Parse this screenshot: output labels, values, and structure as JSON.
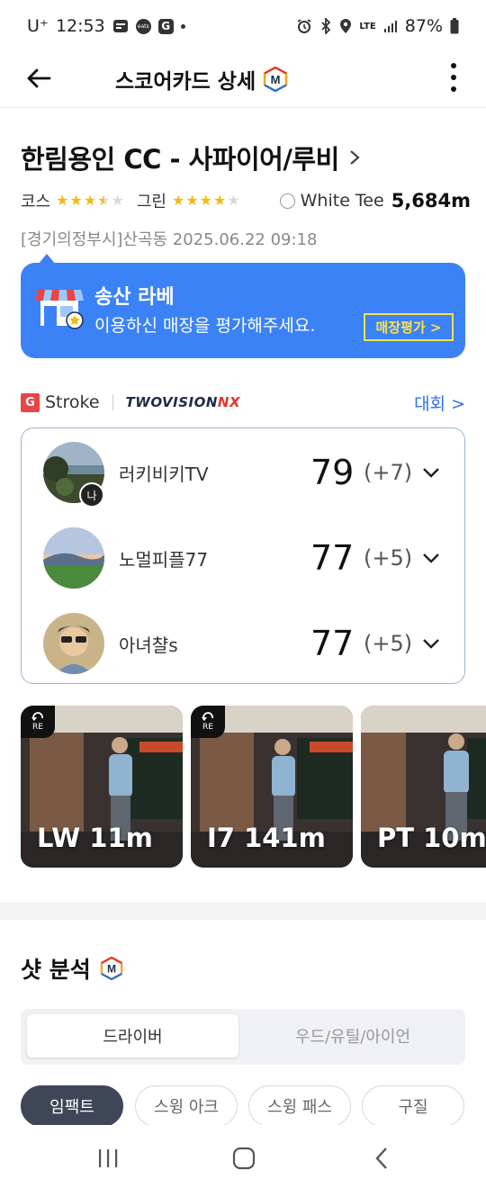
{
  "status_bar": {
    "carrier": "U⁺",
    "time": "12:53",
    "notif_eats": "eats",
    "notif_g": "G",
    "network": "LTE",
    "battery": "87%"
  },
  "header": {
    "title": "스코어카드 상세",
    "m_badge": "M"
  },
  "course": {
    "name": "한림용인 CC - 사파이어/루비",
    "course_label": "코스",
    "course_rating": 3.5,
    "green_label": "그린",
    "green_rating": 4,
    "tee_name": "White Tee",
    "tee_distance": "5,684m",
    "location_datetime": "[경기의정부시]산곡동 2025.06.22 09:18"
  },
  "promo": {
    "store_name": "송산 라베",
    "message": "이용하신 매장을 평가해주세요.",
    "button_label": "매장평가 >"
  },
  "brand": {
    "g_letter": "G",
    "mode": "Stroke",
    "system_main": "TWOVISION",
    "system_accent": "NX",
    "tournament_link": "대회 >"
  },
  "players": [
    {
      "name": "러키비키TV",
      "score": "79",
      "diff": "(+7)",
      "me_badge": "나"
    },
    {
      "name": "노멀피플77",
      "score": "77",
      "diff": "(+5)"
    },
    {
      "name": "아녀챨s",
      "score": "77",
      "diff": "(+5)"
    }
  ],
  "videos": [
    {
      "label": "LW 11m",
      "badge": "RE"
    },
    {
      "label": "I7 141m",
      "badge": "RE"
    },
    {
      "label": "PT 10m"
    }
  ],
  "shot_analysis": {
    "title": "샷 분석",
    "segments": [
      "드라이버",
      "우드/유틸/아이언"
    ],
    "active_segment": "드라이버",
    "chips": [
      "임팩트",
      "스윙 아크",
      "스윙 패스",
      "구질"
    ],
    "active_chip": "임팩트"
  },
  "colors": {
    "promo_bg": "#3b82f6",
    "promo_button": "#ffe14a",
    "link_blue": "#2e6fe6",
    "star_gold": "#f5b914",
    "chip_active": "#3e4657"
  }
}
